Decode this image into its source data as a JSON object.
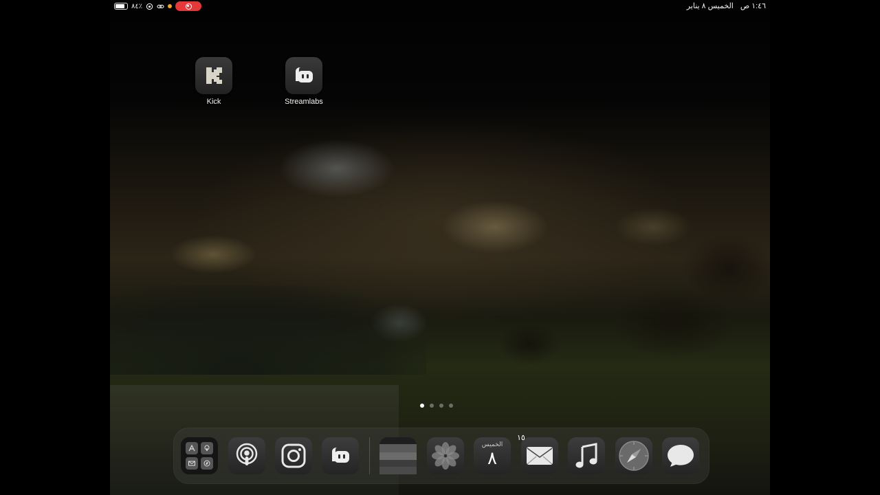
{
  "status_bar": {
    "battery_percent": "٨٤٪",
    "battery_level": 0.84,
    "time": "١:٤٦ ص",
    "date": "الخميس ٨ يناير"
  },
  "home_apps": [
    {
      "label": "Kick",
      "icon": "kick-icon"
    },
    {
      "label": "Streamlabs",
      "icon": "streamlabs-icon"
    }
  ],
  "page_indicator": {
    "count": 4,
    "current": 1
  },
  "dock": {
    "apps": [
      {
        "name": "app-library-folder",
        "icon": "folder-icon"
      },
      {
        "name": "podcasts",
        "icon": "podcasts-icon"
      },
      {
        "name": "instagram",
        "icon": "instagram-icon"
      },
      {
        "name": "streamlabs",
        "icon": "streamlabs-icon"
      },
      {
        "name": "wallet",
        "icon": "wallet-icon"
      },
      {
        "name": "photos",
        "icon": "photos-icon"
      },
      {
        "name": "calendar",
        "icon": "calendar-icon",
        "day_label": "الخميس",
        "day_number": "٨"
      },
      {
        "name": "mail",
        "icon": "mail-icon",
        "badge": "١٥"
      },
      {
        "name": "music",
        "icon": "music-icon"
      },
      {
        "name": "safari",
        "icon": "safari-icon"
      },
      {
        "name": "messages",
        "icon": "messages-icon"
      }
    ]
  }
}
